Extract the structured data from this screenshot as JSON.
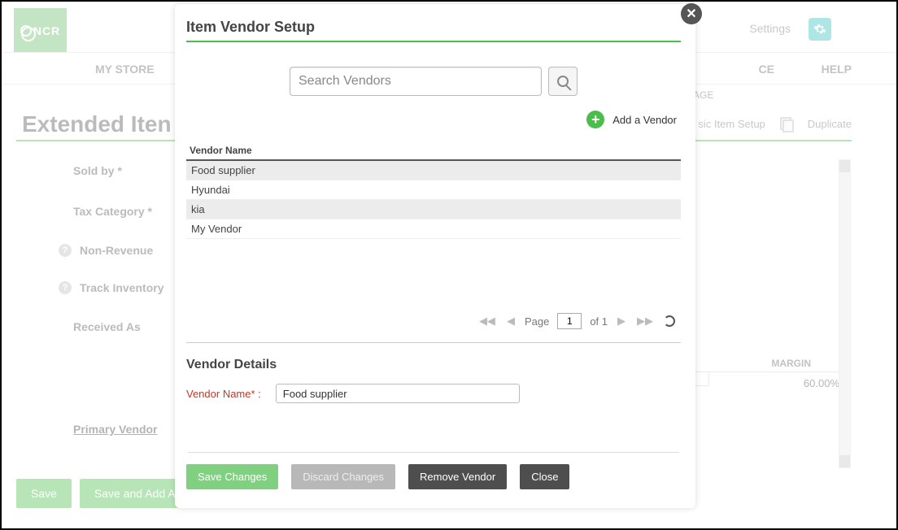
{
  "brand": "NCR",
  "header": {
    "settings": "Settings"
  },
  "nav": {
    "mystore": "MY STORE",
    "ce": "CE",
    "help": "HELP",
    "age": "AGE"
  },
  "page": {
    "title": "Extended Iten",
    "toolbar": {
      "basic": "sic Item Setup",
      "duplicate": "Duplicate"
    },
    "side": {
      "sold_by": "Sold by *",
      "tax_category": "Tax Category *",
      "non_revenue": "Non-Revenue",
      "track_inventory": "Track Inventory",
      "received_as": "Received As",
      "primary_vendor": "Primary Vendor"
    },
    "margin_label": "MARGIN",
    "margin_value": "60.00%",
    "save": "Save",
    "save_add": "Save and Add Anc"
  },
  "modal": {
    "title": "Item Vendor Setup",
    "search_placeholder": "Search Vendors",
    "add_vendor": "Add a Vendor",
    "grid": {
      "header": "Vendor Name",
      "rows": [
        "Food supplier",
        "Hyundai",
        "kia",
        "My Vendor"
      ]
    },
    "pager": {
      "page_label": "Page",
      "page_value": "1",
      "of_label": "of 1"
    },
    "details": {
      "title": "Vendor Details",
      "name_label": "Vendor Name* :",
      "name_value": "Food supplier"
    },
    "actions": {
      "save": "Save Changes",
      "discard": "Discard Changes",
      "remove": "Remove Vendor",
      "close": "Close"
    }
  }
}
